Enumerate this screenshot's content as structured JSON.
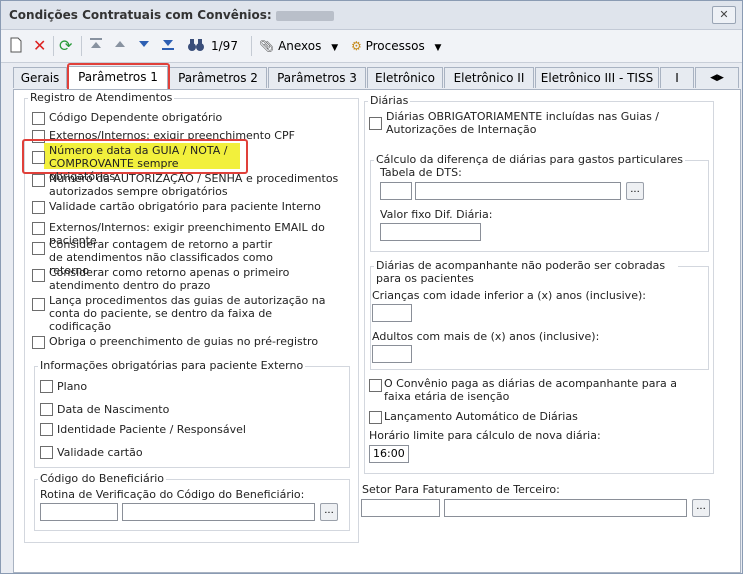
{
  "window": {
    "title": "Condições Contratuais com Convênios:",
    "close_icon": "close-icon"
  },
  "toolbar": {
    "record_counter": "1/97",
    "anexos_label": "Anexos",
    "processos_label": "Processos"
  },
  "tabs": [
    {
      "label": "Gerais"
    },
    {
      "label": "Parâmetros 1",
      "active": true
    },
    {
      "label": "Parâmetros 2"
    },
    {
      "label": "Parâmetros 3"
    },
    {
      "label": "Eletrônico"
    },
    {
      "label": "Eletrônico II"
    },
    {
      "label": "Eletrônico III - TISS"
    },
    {
      "label": "I"
    }
  ],
  "registro": {
    "title": "Registro de Atendimentos",
    "items": [
      "Código Dependente obrigatório",
      "Externos/Internos: exigir preenchimento CPF",
      "Número e data da GUIA / NOTA / COMPROVANTE sempre obrigatórios",
      "Número da AUTORIZAÇÃO / SENHA e procedimentos autorizados sempre obrigatórios",
      "Validade cartão obrigatório para paciente Interno",
      "Externos/Internos: exigir preenchimento EMAIL do paciente",
      "Considerar contagem de retorno a partir de atendimentos não classificados como retorno",
      "Considerar como retorno apenas o primeiro atendimento dentro do prazo",
      "Lança procedimentos das guias de autorização na conta do paciente, se dentro da faixa de codificação",
      "Obriga o preenchimento de guias no pré-registro"
    ]
  },
  "externo": {
    "title": "Informações obrigatórias para paciente Externo",
    "items": [
      "Plano",
      "Data de Nascimento",
      "Identidade Paciente / Responsável",
      "Validade cartão"
    ]
  },
  "beneficiario": {
    "title": "Código do Beneficiário",
    "label": "Rotina de Verificação do Código do Beneficiário:",
    "ellipsis": "..."
  },
  "diarias": {
    "title": "Diárias",
    "obrigatorias": "Diárias OBRIGATORIAMENTE incluídas nas Guias / Autorizações de Internação",
    "calculo": {
      "title": "Cálculo da diferença de diárias para gastos particulares",
      "tabela_label": "Tabela de DTS:",
      "valor_label": "Valor fixo Dif. Diária:",
      "ellipsis": "..."
    },
    "acompanhante": {
      "title": "Diárias de acompanhante não poderão ser cobradas para os pacientes",
      "criancas_label": "Crianças com idade inferior a (x) anos (inclusive):",
      "adultos_label": "Adultos com mais de (x) anos (inclusive):"
    },
    "isencao": "O Convênio paga as diárias de acompanhante para a faixa etária de isenção",
    "lancamento": "Lançamento Automático de Diárias",
    "horario_label": "Horário limite para cálculo de nova diária:",
    "horario_value": "16:00"
  },
  "setor": {
    "label": "Setor Para Faturamento de Terceiro:",
    "ellipsis": "..."
  }
}
